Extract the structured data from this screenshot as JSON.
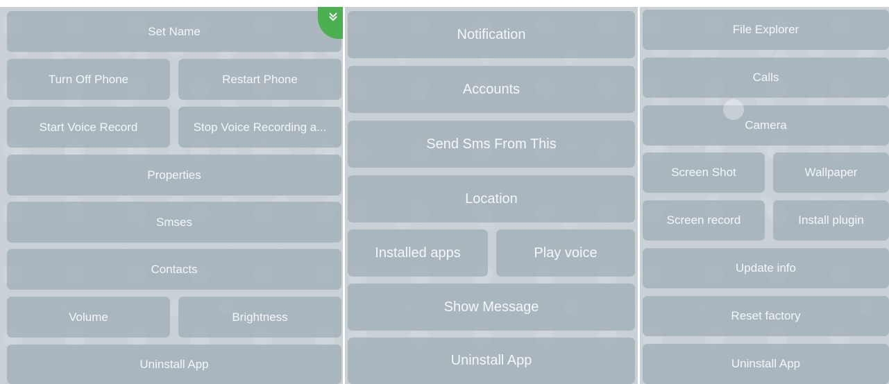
{
  "panel_left": {
    "set_name": "Set Name",
    "turn_off_phone": "Turn Off Phone",
    "restart_phone": "Restart Phone",
    "start_voice_record": "Start Voice Record",
    "stop_voice_recording": "Stop Voice Recording a...",
    "properties": "Properties",
    "smses": "Smses",
    "contacts": "Contacts",
    "volume": "Volume",
    "brightness": "Brightness",
    "uninstall_app": "Uninstall App"
  },
  "panel_middle": {
    "notification": "Notification",
    "accounts": "Accounts",
    "send_sms": "Send Sms From This",
    "location": "Location",
    "installed_apps": "Installed apps",
    "play_voice": "Play voice",
    "show_message": "Show Message",
    "uninstall_app": "Uninstall App"
  },
  "panel_right": {
    "file_explorer": "File Explorer",
    "calls": "Calls",
    "camera": "Camera",
    "screen_shot": "Screen Shot",
    "wallpaper": "Wallpaper",
    "screen_record": "Screen record",
    "install_plugin": "Install plugin",
    "update_info": "Update info",
    "reset_factory": "Reset factory",
    "uninstall_app": "Uninstall App"
  },
  "icons": {
    "collapse": "chevron-double-down-icon"
  },
  "colors": {
    "panel_background": "#c9d1d7",
    "button_background": "#96a4af",
    "button_text": "#f4f7f9",
    "corner_badge": "#4caf50"
  }
}
